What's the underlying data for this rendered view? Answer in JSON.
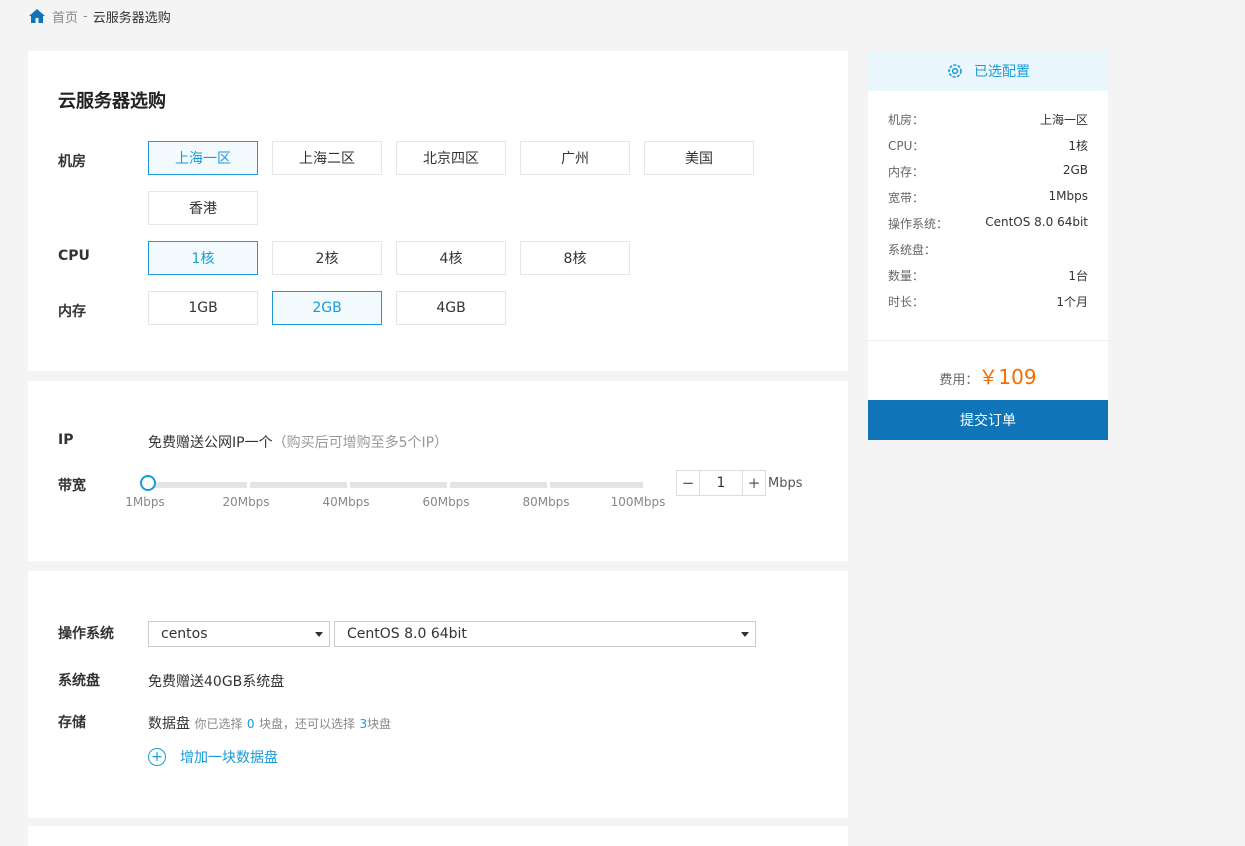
{
  "breadcrumb": {
    "home": "首页",
    "separator": "-",
    "current": "云服务器选购"
  },
  "config": {
    "title": "云服务器选购",
    "datacenter": {
      "label": "机房",
      "options": [
        "上海一区",
        "上海二区",
        "北京四区",
        "广州",
        "美国",
        "香港"
      ],
      "selected": "上海一区"
    },
    "cpu": {
      "label": "CPU",
      "options": [
        "1核",
        "2核",
        "4核",
        "8核"
      ],
      "selected": "1核"
    },
    "memory": {
      "label": "内存",
      "options": [
        "1GB",
        "2GB",
        "4GB"
      ],
      "selected": "2GB"
    }
  },
  "network": {
    "ip_label": "IP",
    "ip_text": "免费赠送公网IP一个",
    "ip_hint": "（购买后可增购至多5个IP）",
    "bandwidth_label": "带宽",
    "ticks": [
      "1Mbps",
      "20Mbps",
      "40Mbps",
      "60Mbps",
      "80Mbps",
      "100Mbps"
    ],
    "value": "1",
    "unit": "Mbps",
    "minus": "−",
    "plus": "+"
  },
  "system": {
    "os_label": "操作系统",
    "os_family": "centos",
    "os_version": "CentOS 8.0 64bit",
    "disk_label": "系统盘",
    "disk_text": "免费赠送40GB系统盘",
    "storage_label": "存储",
    "storage_title": "数据盘",
    "storage_prefix": "你已选择",
    "storage_selected": "0",
    "storage_middle": "块盘，还可以选择",
    "storage_remaining": "3",
    "storage_suffix": "块盘",
    "add_disk": "增加一块数据盘",
    "add_icon": "+"
  },
  "summary": {
    "header": "已选配置",
    "rows": [
      {
        "key": "机房：",
        "value": "上海一区"
      },
      {
        "key": "CPU：",
        "value": "1核"
      },
      {
        "key": "内存：",
        "value": "2GB"
      },
      {
        "key": "宽带：",
        "value": "1Mbps"
      },
      {
        "key": "操作系统：",
        "value": "CentOS 8.0 64bit"
      },
      {
        "key": "系统盘：",
        "value": ""
      },
      {
        "key": "数量：",
        "value": "1台"
      },
      {
        "key": "时长：",
        "value": "1个月"
      }
    ],
    "fee_label": "费用：",
    "fee_value": "￥109",
    "submit": "提交订单"
  },
  "colors": {
    "accent": "#1a9bd7",
    "price": "#f56c00",
    "submit_bg": "#0f75b8"
  },
  "icons": {
    "home": "home-icon",
    "settings": "settings-gear-icon",
    "dropdown": "caret-down-icon",
    "add": "plus-circle-icon"
  }
}
